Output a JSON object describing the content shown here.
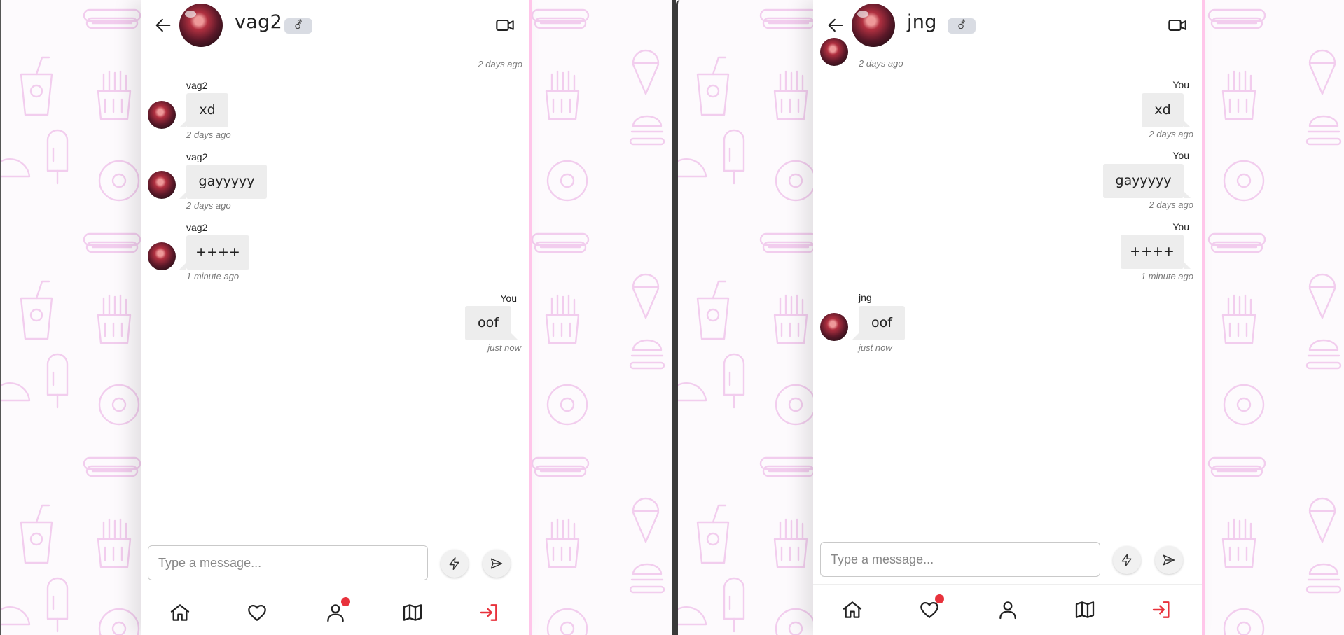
{
  "colors": {
    "pattern_stroke": "#f2cdee",
    "accent_pink": "#ffc6ea",
    "bubble_bg": "#ededed",
    "logout_red": "#e8323c",
    "notification_dot": "#e8323c"
  },
  "left_window": {
    "header": {
      "name": "vag2",
      "gender_symbol": "⚦",
      "icons": [
        "arrow-left-icon",
        "avatar",
        "video-camera-icon"
      ]
    },
    "messages": {
      "top_partial_time": "2 days ago",
      "m1": {
        "sender": "vag2",
        "text": "xd",
        "time": "2 days ago"
      },
      "m2": {
        "sender": "vag2",
        "text": "gayyyyy",
        "time": "2 days ago"
      },
      "m3": {
        "sender": "vag2",
        "text": "++++",
        "time": "1 minute ago"
      },
      "m4": {
        "sender": "You",
        "text": "oof",
        "time": "just now"
      }
    },
    "composer": {
      "placeholder": "Type a message...",
      "icons": [
        "lightning-icon",
        "send-icon"
      ]
    },
    "nav": {
      "items": [
        "home-icon",
        "heart-icon",
        "user-icon",
        "map-icon",
        "logout-icon"
      ],
      "notification_on": "user-icon"
    }
  },
  "right_window": {
    "header": {
      "name": "jng",
      "gender_symbol": "⚦",
      "icons": [
        "arrow-left-icon",
        "avatar",
        "video-camera-icon"
      ]
    },
    "messages": {
      "top_partial_time": "2 days ago",
      "m1": {
        "sender": "You",
        "text": "xd",
        "time": "2 days ago"
      },
      "m2": {
        "sender": "You",
        "text": "gayyyyy",
        "time": "2 days ago"
      },
      "m3": {
        "sender": "You",
        "text": "++++",
        "time": "1 minute ago"
      },
      "m4": {
        "sender": "jng",
        "text": "oof",
        "time": "just now"
      }
    },
    "composer": {
      "placeholder": "Type a message...",
      "icons": [
        "lightning-icon",
        "send-icon"
      ]
    },
    "nav": {
      "items": [
        "home-icon",
        "heart-icon",
        "user-icon",
        "map-icon",
        "logout-icon"
      ],
      "notification_on": "heart-icon"
    }
  }
}
